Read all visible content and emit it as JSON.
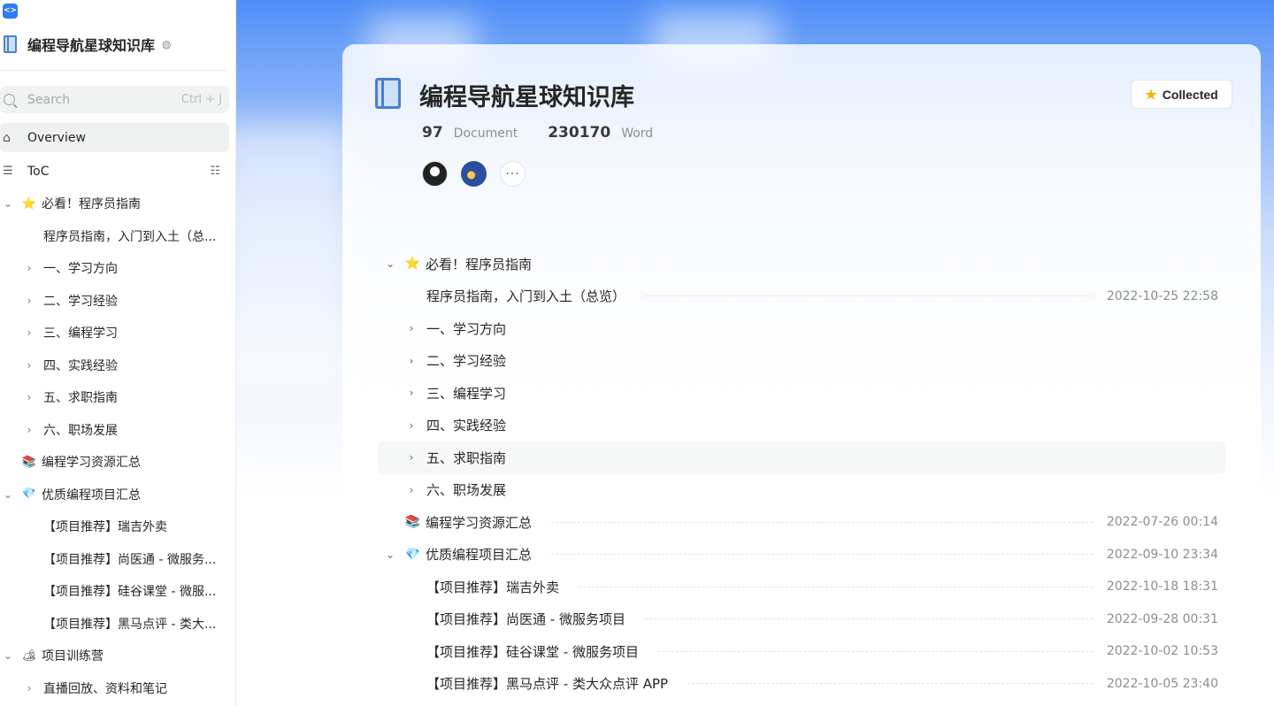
{
  "colors": {
    "accent": "#2f7bf5",
    "star": "#f5b400",
    "book": "#4a7fd0"
  },
  "sidebar": {
    "book_title": "编程导航星球知识库",
    "search": {
      "placeholder": "Search",
      "shortcut": "Ctrl + J"
    },
    "overview_label": "Overview",
    "toc_label": "ToC",
    "items": [
      {
        "level": 0,
        "expanded": true,
        "icon": "star-emoji",
        "glyph": "⭐",
        "label": "必看！程序员指南"
      },
      {
        "level": 1,
        "leaf": true,
        "label": "程序员指南，入门到入土（总..."
      },
      {
        "level": 1,
        "label": "一、学习方向"
      },
      {
        "level": 1,
        "label": "二、学习经验"
      },
      {
        "level": 1,
        "label": "三、编程学习"
      },
      {
        "level": 1,
        "label": "四、实践经验"
      },
      {
        "level": 1,
        "label": "五、求职指南"
      },
      {
        "level": 1,
        "label": "六、职场发展"
      },
      {
        "level": 0,
        "leaf": true,
        "icon": "books-emoji",
        "glyph": "📚",
        "label": "编程学习资源汇总"
      },
      {
        "level": 0,
        "expanded": true,
        "icon": "gem-emoji",
        "glyph": "💎",
        "label": "优质编程项目汇总"
      },
      {
        "level": 1,
        "leaf": true,
        "label": "【项目推荐】瑞吉外卖"
      },
      {
        "level": 1,
        "leaf": true,
        "label": "【项目推荐】尚医通 - 微服务..."
      },
      {
        "level": 1,
        "leaf": true,
        "label": "【项目推荐】硅谷课堂 - 微服..."
      },
      {
        "level": 1,
        "leaf": true,
        "label": "【项目推荐】黑马点评 - 类大..."
      },
      {
        "level": 0,
        "expanded": true,
        "icon": "camping-emoji",
        "glyph": "🏕",
        "label": "项目训练营"
      },
      {
        "level": 1,
        "label": "直播回放、资料和笔记"
      }
    ]
  },
  "main": {
    "title": "编程导航星球知识库",
    "collected_label": "Collected",
    "stats": [
      {
        "value": "97",
        "label": "Document"
      },
      {
        "value": "230170",
        "label": "Word"
      }
    ],
    "more_label": "···",
    "toc": [
      {
        "level": 0,
        "expanded": true,
        "glyph": "⭐",
        "icon": "star-emoji",
        "label": "必看！程序员指南",
        "date": ""
      },
      {
        "level": 1,
        "leaf": true,
        "label": "程序员指南，入门到入土（总览）",
        "date": "2022-10-25 22:58"
      },
      {
        "level": 1,
        "label": "一、学习方向",
        "date": ""
      },
      {
        "level": 1,
        "label": "二、学习经验",
        "date": ""
      },
      {
        "level": 1,
        "label": "三、编程学习",
        "date": ""
      },
      {
        "level": 1,
        "label": "四、实践经验",
        "date": ""
      },
      {
        "level": 1,
        "label": "五、求职指南",
        "date": "",
        "highlight": true
      },
      {
        "level": 1,
        "label": "六、职场发展",
        "date": ""
      },
      {
        "level": 0,
        "leaf": true,
        "glyph": "📚",
        "icon": "books-emoji",
        "label": "编程学习资源汇总",
        "date": "2022-07-26 00:14"
      },
      {
        "level": 0,
        "expanded": true,
        "glyph": "💎",
        "icon": "gem-emoji",
        "label": "优质编程项目汇总",
        "date": "2022-09-10 23:34"
      },
      {
        "level": 1,
        "leaf": true,
        "label": "【项目推荐】瑞吉外卖",
        "date": "2022-10-18 18:31"
      },
      {
        "level": 1,
        "leaf": true,
        "label": "【项目推荐】尚医通 - 微服务项目",
        "date": "2022-09-28 00:31"
      },
      {
        "level": 1,
        "leaf": true,
        "label": "【项目推荐】硅谷课堂 - 微服务项目",
        "date": "2022-10-02 10:53"
      },
      {
        "level": 1,
        "leaf": true,
        "label": "【项目推荐】黑马点评 - 类大众点评 APP",
        "date": "2022-10-05 23:40"
      }
    ]
  }
}
